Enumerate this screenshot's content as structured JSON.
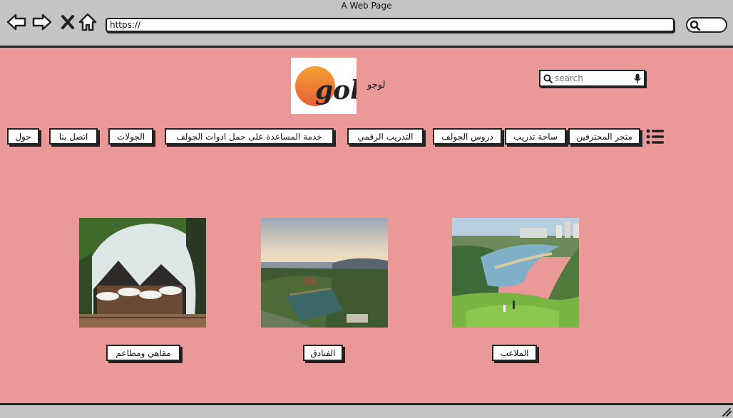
{
  "window": {
    "title": "A Web Page"
  },
  "browser": {
    "url": "https://"
  },
  "header": {
    "logo_word": "golf",
    "logo_label": "لوجو",
    "search_placeholder": "search"
  },
  "nav": {
    "items": [
      {
        "label": "متجر المحترفين"
      },
      {
        "label": "ساحة تدريب"
      },
      {
        "label": "دروس الجولف"
      },
      {
        "label": "التدريب الرقمي"
      },
      {
        "label": "خدمة المساعدة على حمل ادوات الجولف"
      },
      {
        "label": "الجولات"
      },
      {
        "label": "اتصل بنا"
      },
      {
        "label": "حول"
      }
    ]
  },
  "cards": [
    {
      "label": "الملاعب",
      "image": "golf-course-photo"
    },
    {
      "label": "الفنادق",
      "image": "hotel-resort-photo"
    },
    {
      "label": "مقاهي ومطاعم",
      "image": "restaurant-photo"
    }
  ],
  "colors": {
    "page_bg": "#eb9898",
    "chrome_bg": "#c4c4c4",
    "logo_orange": "#f07a2a"
  }
}
